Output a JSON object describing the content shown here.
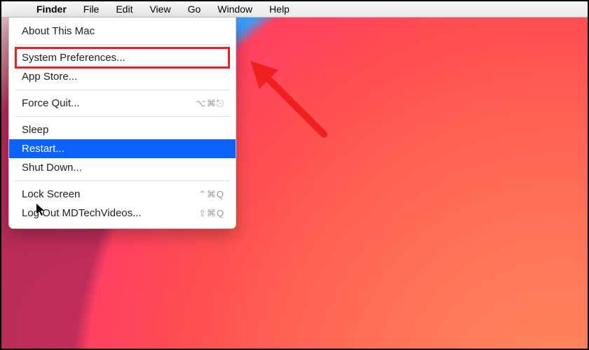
{
  "menubar": {
    "apple_icon": "",
    "items": [
      "Finder",
      "File",
      "Edit",
      "View",
      "Go",
      "Window",
      "Help"
    ],
    "active_index": 0
  },
  "apple_menu": {
    "about": "About This Mac",
    "system_prefs": "System Preferences...",
    "app_store": "App Store...",
    "force_quit": "Force Quit...",
    "force_quit_sc": "⌥⌘⎋",
    "sleep": "Sleep",
    "restart": "Restart...",
    "shutdown": "Shut Down...",
    "lock_screen": "Lock Screen",
    "lock_screen_sc": "⌃⌘Q",
    "logout": "Log Out MDTechVideos...",
    "logout_sc": "⇧⌘Q"
  },
  "annotation": {
    "highlighted_item": "system_prefs",
    "selected_item": "restart",
    "arrow_color": "#f02020"
  }
}
